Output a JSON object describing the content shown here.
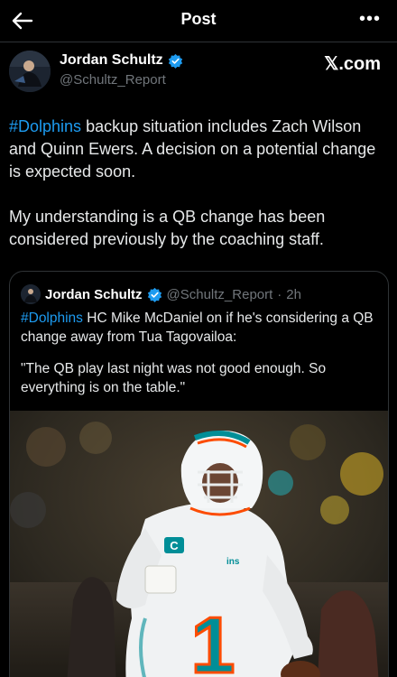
{
  "header": {
    "title": "Post",
    "back_icon": "arrow-left-icon",
    "more_icon": "more-dots-icon",
    "more_label": "•••"
  },
  "post": {
    "author_name": "Jordan Schultz",
    "author_handle": "@Schultz_Report",
    "source_label": "𝕏.com",
    "para1_tag": "#Dolphins",
    "para1_rest": " backup situation includes Zach Wilson and Quinn Ewers. A decision on a potential change is expected soon.",
    "para2": "My understanding is a QB change has been considered previously by the coaching staff."
  },
  "quoted": {
    "author_name": "Jordan Schultz",
    "author_handle": "@Schultz_Report",
    "separator": "·",
    "time": "2h",
    "para1_tag": "#Dolphins",
    "para1_rest": " HC Mike McDaniel on if he's considering a QB change away from Tua Tagovailoa:",
    "para2": "\"The QB play last night was not good enough. So everything is on the table.\"",
    "image_alt": "Dolphins quarterback in white uniform and helmet running with football",
    "jersey_number": "1",
    "captain_patch": "C"
  },
  "colors": {
    "background": "#000000",
    "accent_blue": "#1d9bf0",
    "muted_text": "#71767b",
    "divider": "#2f3336",
    "dolphins_aqua": "#008e97",
    "dolphins_orange": "#fc4c02"
  }
}
